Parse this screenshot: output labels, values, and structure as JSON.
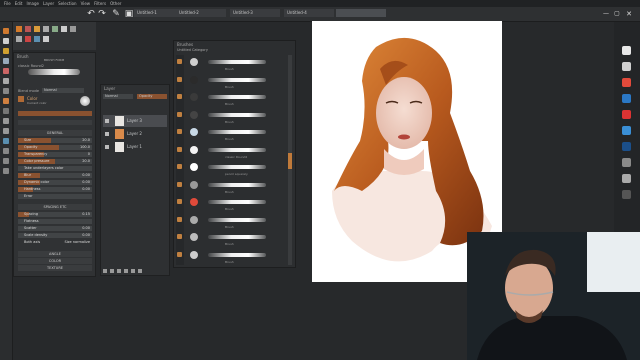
{
  "menu": {
    "items": [
      "File",
      "Edit",
      "Image",
      "Layer",
      "Selection",
      "View",
      "Filters",
      "Other"
    ]
  },
  "tabs": [
    {
      "label": "Untitled-1",
      "active": false
    },
    {
      "label": "Untitled-2",
      "active": false
    },
    {
      "label": "Untitled-3",
      "active": false
    },
    {
      "label": "Untitled-4",
      "active": true
    }
  ],
  "tool_options": {
    "title": "Brush",
    "preset_label": "BRUSH FORM",
    "brush_name": "classic Round2"
  },
  "brush_settings": {
    "blend_label": "Blend mode",
    "blend_value": "Normal",
    "color_label": "Color",
    "color_sub": "Current color",
    "section_general": "GENERAL",
    "rows": [
      {
        "label": "Size",
        "value": "20.0",
        "fill": 0.45
      },
      {
        "label": "Opacity",
        "value": "100.0",
        "fill": 0.55
      },
      {
        "label": "Transparency",
        "value": "0",
        "fill": 0.35
      },
      {
        "label": "Color pressure",
        "value": "20.0",
        "fill": 0.5
      },
      {
        "label": "Take underlayers color",
        "value": "",
        "fill": 0.0
      },
      {
        "label": "Blur",
        "value": "0.00",
        "fill": 0.3
      },
      {
        "label": "Dynamic color",
        "value": "0.00",
        "fill": 0.3
      },
      {
        "label": "Hardness",
        "value": "0.00",
        "fill": 0.2
      },
      {
        "label": "Error",
        "value": "",
        "fill": 0.0
      }
    ],
    "section_spacing": "SPACING ETC",
    "rows2": [
      {
        "label": "Spacing",
        "value": "0.15",
        "fill": 0.15
      },
      {
        "label": "Flatness",
        "value": "",
        "fill": 0.0
      },
      {
        "label": "Scatter",
        "value": "0.00",
        "fill": 0.0
      },
      {
        "label": "Scale density",
        "value": "0.00",
        "fill": 0.0
      },
      {
        "label": "Both axis",
        "value": "Size normalize",
        "fill": 0.0
      }
    ],
    "footer": [
      "ANGLE",
      "COLOR",
      "TEXTURE"
    ]
  },
  "layers": {
    "title": "Layer",
    "blend": "Normal",
    "opacity_label": "Opacity",
    "items": [
      {
        "name": "Layer 3"
      },
      {
        "name": "Layer 2"
      },
      {
        "name": "Layer 1"
      }
    ]
  },
  "brushes": {
    "title": "Brushes",
    "category": "Untitled Category",
    "items": [
      {
        "name": "Brush",
        "thumb": "#cfcfcf"
      },
      {
        "name": "Brush",
        "thumb": "#2b2b2b"
      },
      {
        "name": "Brush",
        "thumb": "#3a3a3a"
      },
      {
        "name": "Brush",
        "thumb": "#444444"
      },
      {
        "name": "Brush",
        "thumb": "#c8d8e6"
      },
      {
        "name": "classic Round2",
        "thumb": "#f3f3f3"
      },
      {
        "name": "pencil squarely",
        "thumb": "#ffffff"
      },
      {
        "name": "Brush",
        "thumb": "#999999"
      },
      {
        "name": "Brush",
        "thumb": "#e04a3a"
      },
      {
        "name": "Brush",
        "thumb": "#aaaaaa"
      },
      {
        "name": "Brush",
        "thumb": "#bbbbbb"
      },
      {
        "name": "Brush",
        "thumb": "#cccccc"
      }
    ]
  },
  "colors": {
    "accent": "#8a5230",
    "panel": "#303234",
    "bg": "#27292b"
  }
}
